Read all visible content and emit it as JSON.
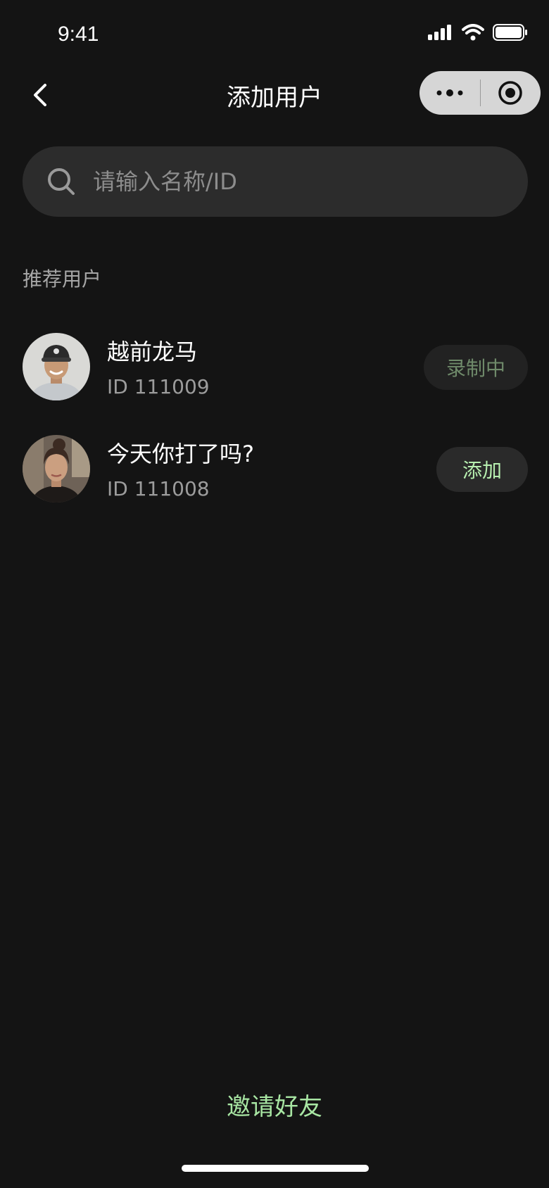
{
  "status_bar": {
    "time": "9:41",
    "icons": [
      "signal-icon",
      "wifi-icon",
      "battery-icon"
    ]
  },
  "nav": {
    "title": "添加用户",
    "back_icon": "chevron-left-icon",
    "capsule_icons": [
      "more-dots-icon",
      "record-target-icon"
    ]
  },
  "search": {
    "placeholder": "请输入名称/ID",
    "value": ""
  },
  "recommended": {
    "label": "推荐用户",
    "users": [
      {
        "name": "越前龙马",
        "id_text": "ID 111009",
        "action": "录制中",
        "action_state": "disabled"
      },
      {
        "name": "今天你打了吗?",
        "id_text": "ID 111008",
        "action": "添加",
        "action_state": "enabled"
      }
    ]
  },
  "footer": {
    "invite_label": "邀请好友"
  },
  "colors": {
    "background": "#141414",
    "accent_green": "#a8e6a3",
    "muted_green": "#6f8a6a",
    "surface": "#2c2c2c"
  }
}
